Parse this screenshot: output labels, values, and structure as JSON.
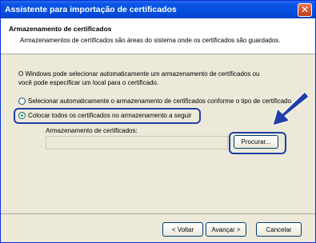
{
  "window": {
    "title": "Assistente para importação de certificados",
    "close_symbol": "✕"
  },
  "header": {
    "title": "Armazenamento de certificados",
    "subtitle": "Armazenamentos de certificados são áreas do sistema onde os certificados são guardados."
  },
  "body": {
    "intro_line1": "O Windows pode selecionar automaticamente um armazenamento de certificados ou",
    "intro_line2": "você pode especificar um local para o certificado.",
    "option_auto": {
      "label": "Selecionar automaticamente o armazenamento de certificados conforme o tipo de certificado",
      "checked": false
    },
    "option_manual": {
      "label": "Colocar todos os certificados no armazenamento a seguir",
      "checked": true
    },
    "store_label": "Armazenamento de certificados:",
    "store_value": "",
    "browse_label": "Procurar..."
  },
  "footer": {
    "back": "< Voltar",
    "next": "Avançar >",
    "cancel": "Cancelar"
  },
  "annotations": {
    "highlight_color": "#1f3fa8",
    "arrow_color": "#1f3fa8"
  }
}
